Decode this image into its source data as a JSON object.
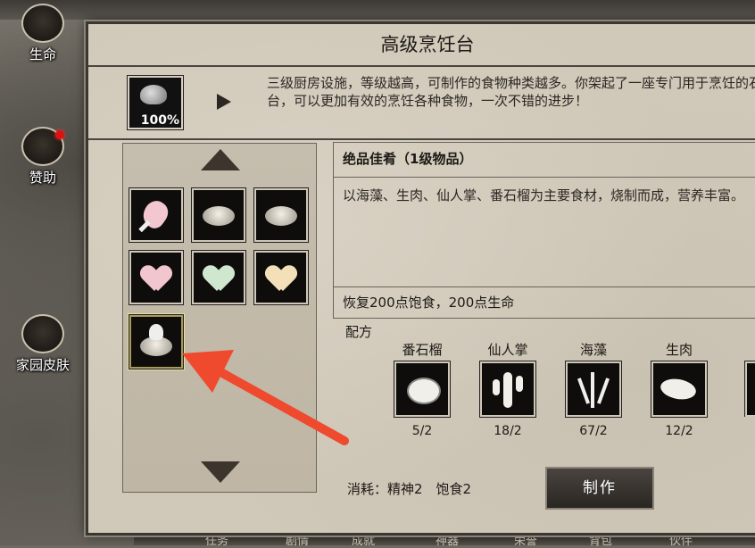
{
  "sidebar": {
    "items": [
      {
        "label": "生命",
        "icon": "life-icon"
      },
      {
        "label": "赞助",
        "icon": "sponsor-chest-icon"
      },
      {
        "label": "家园皮肤",
        "icon": "home-skin-icon"
      }
    ]
  },
  "bottom_tabs": [
    "任务",
    "剧情",
    "成就",
    "神器",
    "荣誉",
    "背包",
    "伙伴"
  ],
  "panel": {
    "title": "高级烹饪台",
    "facility": {
      "icon": "cooking-pot-icon",
      "level_text": "100%"
    },
    "description": "三级厨房设施，等级越高，可制作的食物种类越多。你架起了一座专门用于烹饪的石台，可以更加有效的烹饪各种食物，一次不错的进步！"
  },
  "item_list": {
    "items": [
      {
        "icon": "meat-leg-icon"
      },
      {
        "icon": "bowl-dish-icon"
      },
      {
        "icon": "bowl-dish-icon"
      },
      {
        "icon": "pink-heart-icon",
        "color": "#f2c6cf"
      },
      {
        "icon": "green-heart-icon",
        "color": "#cfe7cf"
      },
      {
        "icon": "yellow-heart-icon",
        "color": "#f3e0b8"
      },
      {
        "icon": "premium-dish-icon",
        "selected": true
      }
    ]
  },
  "detail": {
    "name": "绝品佳肴（1级物品）",
    "description": "以海藻、生肉、仙人掌、番石榴为主要食材，烧制而成，营养丰富。",
    "effect": "恢复200点饱食，200点生命"
  },
  "recipe": {
    "label": "配方",
    "ingredients": [
      {
        "name": "番石榴",
        "count": "5/2",
        "icon": "guava-icon"
      },
      {
        "name": "仙人掌",
        "count": "18/2",
        "icon": "cactus-icon"
      },
      {
        "name": "海藻",
        "count": "67/2",
        "icon": "seaweed-icon"
      },
      {
        "name": "生肉",
        "count": "12/2",
        "icon": "raw-meat-icon"
      }
    ]
  },
  "cost": {
    "label": "消耗：精神2　饱食2"
  },
  "actions": {
    "make_label": "制作"
  },
  "colors": {
    "annotation_arrow": "#ef4a2e",
    "panel_bg": "#d0c8b8"
  }
}
